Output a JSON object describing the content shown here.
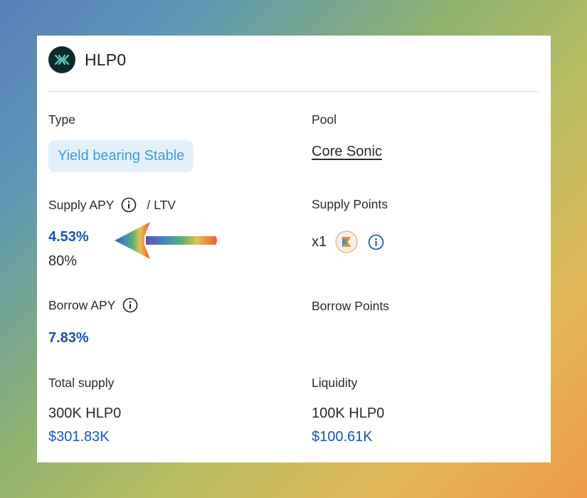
{
  "asset": {
    "name": "HLP0",
    "icon": "hlp0-logo-icon"
  },
  "type": {
    "label": "Type",
    "value": "Yield bearing Stable"
  },
  "pool": {
    "label": "Pool",
    "value": "Core Sonic"
  },
  "supply": {
    "label": "Supply APY",
    "ltv_label": "/ LTV",
    "apy": "4.53%",
    "ltv": "80%",
    "info_icon": "info-circle-icon"
  },
  "supply_points": {
    "label": "Supply Points",
    "multiplier": "x1",
    "token_icon": "points-token-icon",
    "info_icon": "info-circle-icon"
  },
  "borrow": {
    "label": "Borrow APY",
    "apy": "7.83%",
    "info_icon": "info-circle-icon"
  },
  "borrow_points": {
    "label": "Borrow Points"
  },
  "total_supply": {
    "label": "Total supply",
    "amount": "300K HLP0",
    "usd": "$301.83K"
  },
  "liquidity": {
    "label": "Liquidity",
    "amount": "100K HLP0",
    "usd": "$100.61K"
  },
  "annotation": {
    "icon": "gradient-arrow-icon"
  },
  "colors": {
    "accent_blue": "#1c55b0",
    "badge_bg": "#e4f1fb",
    "badge_text": "#3d9bd9",
    "logo_bg": "#0f2a2a"
  }
}
